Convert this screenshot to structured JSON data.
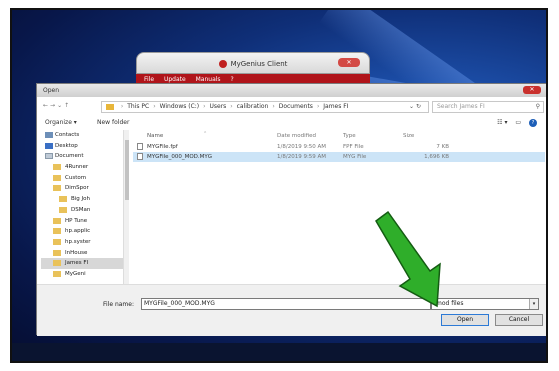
{
  "client": {
    "title": "MyGenius Client",
    "menu": [
      "File",
      "Update",
      "Manuals",
      "?"
    ]
  },
  "dialog": {
    "title": "Open",
    "address": {
      "crumbs": [
        "This PC",
        "Windows (C:)",
        "Users",
        "calibration",
        "Documents",
        "James FI"
      ],
      "search_placeholder": "Search James FI"
    },
    "toolbar": {
      "organize": "Organize ▾",
      "new_folder": "New folder"
    },
    "nav_items": [
      {
        "label": "Contacts",
        "icon": "contacts"
      },
      {
        "label": "Desktop",
        "icon": "desktop"
      },
      {
        "label": "Document",
        "icon": "doc"
      },
      {
        "label": "4Runner",
        "icon": "folder"
      },
      {
        "label": "Custom",
        "icon": "folder"
      },
      {
        "label": "DimSpor",
        "icon": "folder"
      },
      {
        "label": "Big Joh",
        "icon": "folder"
      },
      {
        "label": "DSMan",
        "icon": "folder"
      },
      {
        "label": "HP Tune",
        "icon": "folder"
      },
      {
        "label": "hp.applic",
        "icon": "folder"
      },
      {
        "label": "hp.syster",
        "icon": "folder"
      },
      {
        "label": "InHouse",
        "icon": "folder"
      },
      {
        "label": "James FI",
        "icon": "folder"
      },
      {
        "label": "MyGeni",
        "icon": "folder"
      }
    ],
    "columns": {
      "name": "Name",
      "date": "Date modified",
      "type": "Type",
      "size": "Size"
    },
    "files": [
      {
        "name": "MYGFile.fpf",
        "date": "1/8/2019 9:50 AM",
        "type": "FPF File",
        "size": "7 KB"
      },
      {
        "name": "MYGFile_000_MOD.MYG",
        "date": "1/8/2019 9:59 AM",
        "type": "MYG File",
        "size": "1,696 KB"
      }
    ],
    "filename_label": "File name:",
    "filename_value": "MYGFile_000_MOD.MYG",
    "filter_value": "mod files",
    "open_label": "Open",
    "cancel_label": "Cancel"
  },
  "colors": {
    "arrow": "#2fae2a",
    "selection": "#cce4f7",
    "client_red": "#b0141a"
  }
}
